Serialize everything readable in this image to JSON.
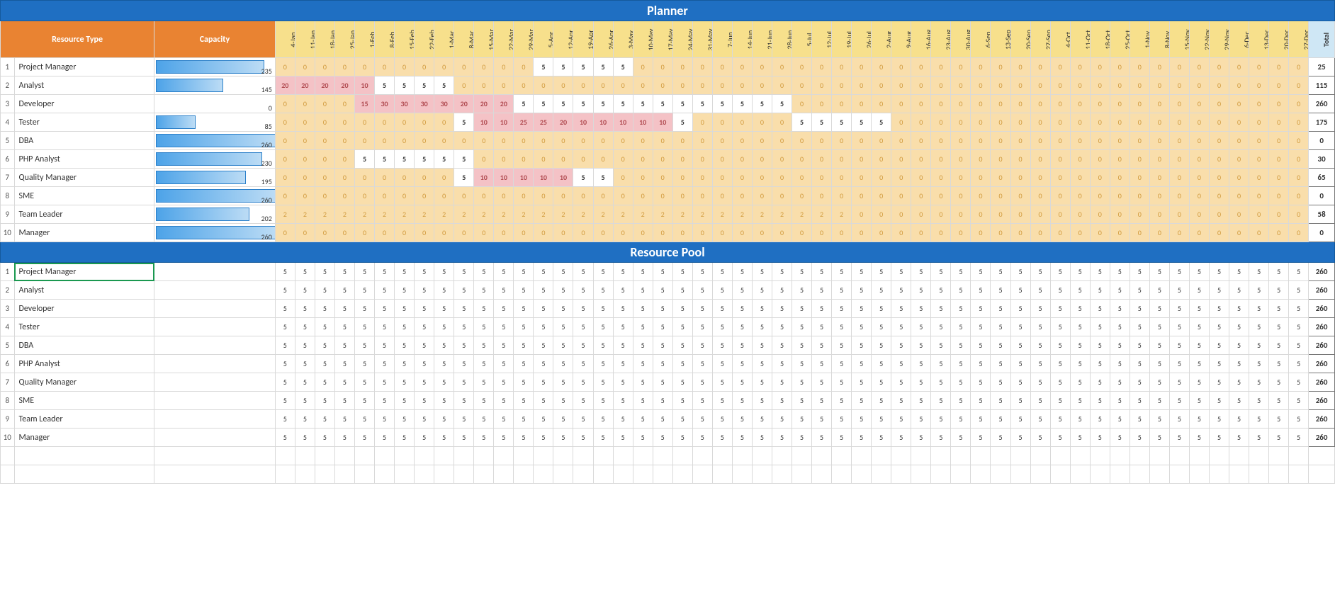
{
  "titles": {
    "planner": "Planner",
    "pool": "Resource Pool"
  },
  "headers": {
    "resourceType": "Resource Type",
    "capacity": "Capacity",
    "total": "Total"
  },
  "dates": [
    "4-Jan",
    "11-Jan",
    "18-Jan",
    "25-Jan",
    "1-Feb",
    "8-Feb",
    "15-Feb",
    "22-Feb",
    "1-Mar",
    "8-Mar",
    "15-Mar",
    "22-Mar",
    "29-Mar",
    "5-Apr",
    "12-Apr",
    "19-Apr",
    "26-Apr",
    "3-May",
    "10-May",
    "17-May",
    "24-May",
    "31-May",
    "7-Jun",
    "14-Jun",
    "21-Jun",
    "28-Jun",
    "5-Jul",
    "12-Jul",
    "19-Jul",
    "26-Jul",
    "2-Aug",
    "9-Aug",
    "16-Aug",
    "23-Aug",
    "30-Aug",
    "6-Sep",
    "13-Sep",
    "20-Sep",
    "27-Sep",
    "4-Oct",
    "11-Oct",
    "18-Oct",
    "25-Oct",
    "1-Nov",
    "8-Nov",
    "15-Nov",
    "22-Nov",
    "29-Nov",
    "6-Dec",
    "13-Dec",
    "20-Dec",
    "27-Dec"
  ],
  "maxCapacity": 260,
  "planner": [
    {
      "num": 1,
      "name": "Project Manager",
      "capacity": 235,
      "total": 25,
      "values": [
        0,
        0,
        0,
        0,
        0,
        0,
        0,
        0,
        0,
        0,
        0,
        0,
        0,
        5,
        5,
        5,
        5,
        5,
        0,
        0,
        0,
        0,
        0,
        0,
        0,
        0,
        0,
        0,
        0,
        0,
        0,
        0,
        0,
        0,
        0,
        0,
        0,
        0,
        0,
        0,
        0,
        0,
        0,
        0,
        0,
        0,
        0,
        0,
        0,
        0,
        0,
        0
      ]
    },
    {
      "num": 2,
      "name": "Analyst",
      "capacity": 145,
      "total": 115,
      "values": [
        20,
        20,
        20,
        20,
        10,
        5,
        5,
        5,
        5,
        0,
        0,
        0,
        0,
        0,
        0,
        0,
        0,
        0,
        0,
        0,
        0,
        0,
        0,
        0,
        0,
        0,
        0,
        0,
        0,
        0,
        0,
        0,
        0,
        0,
        0,
        0,
        0,
        0,
        0,
        0,
        0,
        0,
        0,
        0,
        0,
        0,
        0,
        0,
        0,
        0,
        0,
        0
      ]
    },
    {
      "num": 3,
      "name": "Developer",
      "capacity": 0,
      "total": 260,
      "values": [
        0,
        0,
        0,
        0,
        15,
        30,
        30,
        30,
        30,
        20,
        20,
        20,
        5,
        5,
        5,
        5,
        5,
        5,
        5,
        5,
        5,
        5,
        5,
        5,
        5,
        5,
        0,
        0,
        0,
        0,
        0,
        0,
        0,
        0,
        0,
        0,
        0,
        0,
        0,
        0,
        0,
        0,
        0,
        0,
        0,
        0,
        0,
        0,
        0,
        0,
        0,
        0
      ]
    },
    {
      "num": 4,
      "name": "Tester",
      "capacity": 85,
      "total": 175,
      "values": [
        0,
        0,
        0,
        0,
        0,
        0,
        0,
        0,
        0,
        5,
        10,
        10,
        25,
        25,
        20,
        10,
        10,
        10,
        10,
        10,
        5,
        0,
        0,
        0,
        0,
        0,
        5,
        5,
        5,
        5,
        5,
        0,
        0,
        0,
        0,
        0,
        0,
        0,
        0,
        0,
        0,
        0,
        0,
        0,
        0,
        0,
        0,
        0,
        0,
        0,
        0,
        0
      ]
    },
    {
      "num": 5,
      "name": "DBA",
      "capacity": 260,
      "total": 0,
      "values": [
        0,
        0,
        0,
        0,
        0,
        0,
        0,
        0,
        0,
        0,
        0,
        0,
        0,
        0,
        0,
        0,
        0,
        0,
        0,
        0,
        0,
        0,
        0,
        0,
        0,
        0,
        0,
        0,
        0,
        0,
        0,
        0,
        0,
        0,
        0,
        0,
        0,
        0,
        0,
        0,
        0,
        0,
        0,
        0,
        0,
        0,
        0,
        0,
        0,
        0,
        0,
        0
      ]
    },
    {
      "num": 6,
      "name": "PHP Analyst",
      "capacity": 230,
      "total": 30,
      "values": [
        0,
        0,
        0,
        0,
        5,
        5,
        5,
        5,
        5,
        5,
        0,
        0,
        0,
        0,
        0,
        0,
        0,
        0,
        0,
        0,
        0,
        0,
        0,
        0,
        0,
        0,
        0,
        0,
        0,
        0,
        0,
        0,
        0,
        0,
        0,
        0,
        0,
        0,
        0,
        0,
        0,
        0,
        0,
        0,
        0,
        0,
        0,
        0,
        0,
        0,
        0,
        0
      ]
    },
    {
      "num": 7,
      "name": "Quality Manager",
      "capacity": 195,
      "total": 65,
      "values": [
        0,
        0,
        0,
        0,
        0,
        0,
        0,
        0,
        0,
        5,
        10,
        10,
        10,
        10,
        10,
        5,
        5,
        0,
        0,
        0,
        0,
        0,
        0,
        0,
        0,
        0,
        0,
        0,
        0,
        0,
        0,
        0,
        0,
        0,
        0,
        0,
        0,
        0,
        0,
        0,
        0,
        0,
        0,
        0,
        0,
        0,
        0,
        0,
        0,
        0,
        0,
        0
      ]
    },
    {
      "num": 8,
      "name": "SME",
      "capacity": 260,
      "total": 0,
      "values": [
        0,
        0,
        0,
        0,
        0,
        0,
        0,
        0,
        0,
        0,
        0,
        0,
        0,
        0,
        0,
        0,
        0,
        0,
        0,
        0,
        0,
        0,
        0,
        0,
        0,
        0,
        0,
        0,
        0,
        0,
        0,
        0,
        0,
        0,
        0,
        0,
        0,
        0,
        0,
        0,
        0,
        0,
        0,
        0,
        0,
        0,
        0,
        0,
        0,
        0,
        0,
        0
      ]
    },
    {
      "num": 9,
      "name": "Team Leader",
      "capacity": 202,
      "total": 58,
      "values": [
        2,
        2,
        2,
        2,
        2,
        2,
        2,
        2,
        2,
        2,
        2,
        2,
        2,
        2,
        2,
        2,
        2,
        2,
        2,
        2,
        2,
        2,
        2,
        2,
        2,
        2,
        2,
        2,
        2,
        0,
        0,
        0,
        0,
        0,
        0,
        0,
        0,
        0,
        0,
        0,
        0,
        0,
        0,
        0,
        0,
        0,
        0,
        0,
        0,
        0,
        0,
        0
      ]
    },
    {
      "num": 10,
      "name": "Manager",
      "capacity": 260,
      "total": 0,
      "values": [
        0,
        0,
        0,
        0,
        0,
        0,
        0,
        0,
        0,
        0,
        0,
        0,
        0,
        0,
        0,
        0,
        0,
        0,
        0,
        0,
        0,
        0,
        0,
        0,
        0,
        0,
        0,
        0,
        0,
        0,
        0,
        0,
        0,
        0,
        0,
        0,
        0,
        0,
        0,
        0,
        0,
        0,
        0,
        0,
        0,
        0,
        0,
        0,
        0,
        0,
        0,
        0
      ]
    }
  ],
  "pool": [
    {
      "num": 1,
      "name": "Project Manager",
      "value": 5,
      "total": 260,
      "selected": true
    },
    {
      "num": 2,
      "name": "Analyst",
      "value": 5,
      "total": 260
    },
    {
      "num": 3,
      "name": "Developer",
      "value": 5,
      "total": 260
    },
    {
      "num": 4,
      "name": "Tester",
      "value": 5,
      "total": 260
    },
    {
      "num": 5,
      "name": "DBA",
      "value": 5,
      "total": 260
    },
    {
      "num": 6,
      "name": "PHP Analyst",
      "value": 5,
      "total": 260
    },
    {
      "num": 7,
      "name": "Quality Manager",
      "value": 5,
      "total": 260
    },
    {
      "num": 8,
      "name": "SME",
      "value": 5,
      "total": 260
    },
    {
      "num": 9,
      "name": "Team Leader",
      "value": 5,
      "total": 260
    },
    {
      "num": 10,
      "name": "Manager",
      "value": 5,
      "total": 260
    }
  ]
}
